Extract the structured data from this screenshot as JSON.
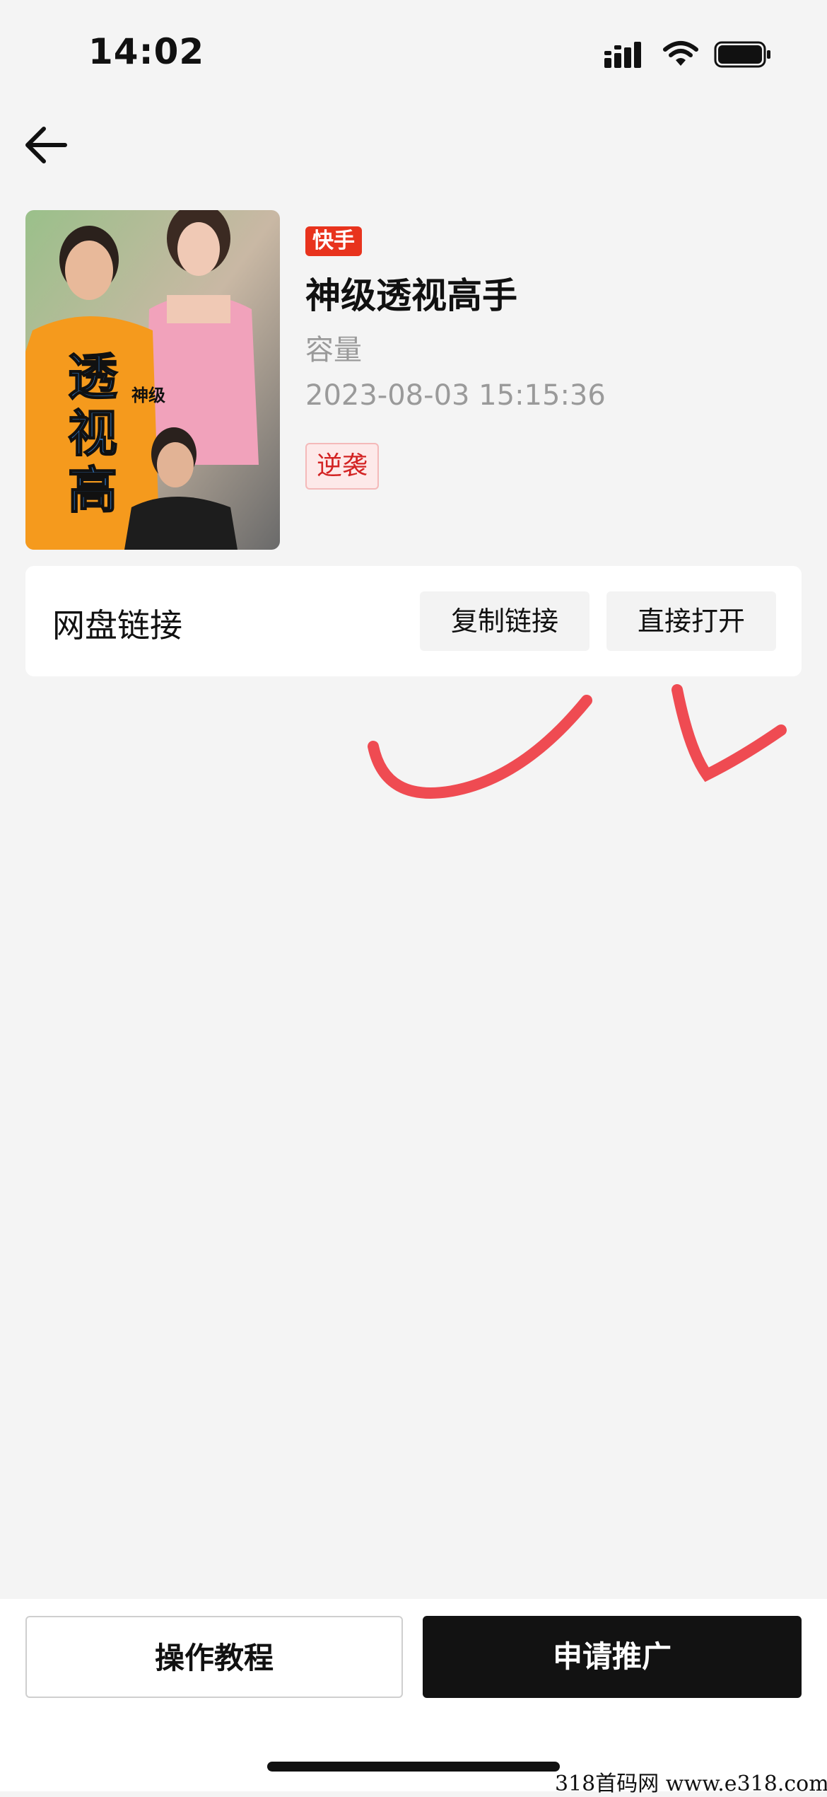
{
  "status_bar": {
    "time": "14:02",
    "icons": [
      "signal-icon",
      "wifi-icon",
      "battery-icon"
    ]
  },
  "nav": {
    "back_icon": "arrow-left-icon"
  },
  "drama": {
    "platform": "快手",
    "title": "神级透视高手",
    "capacity_label": "容量",
    "timestamp": "2023-08-03 15:15:36",
    "genre": "逆袭",
    "poster_text_main": "透视高手",
    "poster_text_sub": "神级"
  },
  "link_card": {
    "label": "网盘链接",
    "copy_button": "复制链接",
    "open_button": "直接打开"
  },
  "bottom_bar": {
    "tutorial_button": "操作教程",
    "promote_button": "申请推广"
  },
  "watermark": "318首码网  www.e318.com",
  "colors": {
    "platform_badge": "#e8331d",
    "genre_tag_text": "#d32323",
    "check_mark": "#ef4b52",
    "primary_button": "#121212",
    "background": "#f4f4f4"
  }
}
